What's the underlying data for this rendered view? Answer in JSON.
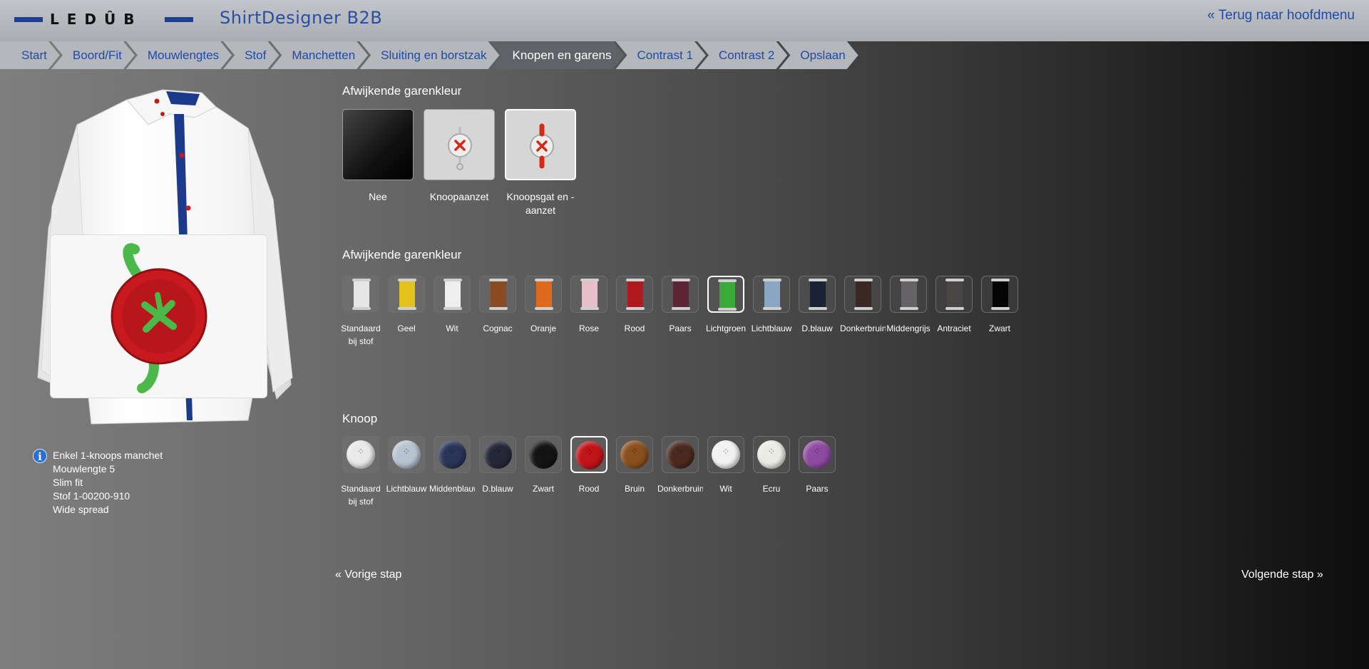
{
  "header": {
    "logo_text": "LEDÛB",
    "app_title": "ShirtDesigner B2B",
    "back_link": "« Terug naar hoofdmenu"
  },
  "breadcrumbs": [
    {
      "label": "Start",
      "active": false
    },
    {
      "label": "Boord/Fit",
      "active": false
    },
    {
      "label": "Mouwlengtes",
      "active": false
    },
    {
      "label": "Stof",
      "active": false
    },
    {
      "label": "Manchetten",
      "active": false
    },
    {
      "label": "Sluiting en borstzak",
      "active": false
    },
    {
      "label": "Knopen en garens",
      "active": true
    },
    {
      "label": "Contrast 1",
      "active": false
    },
    {
      "label": "Contrast 2",
      "active": false
    },
    {
      "label": "Opslaan",
      "active": false
    }
  ],
  "info": {
    "lines": [
      "Enkel 1-knoops manchet",
      "Mouwlengte 5",
      "Slim fit",
      "Stof 1-00200-910",
      "Wide spread"
    ]
  },
  "thread_option": {
    "title": "Afwijkende garenkleur",
    "options": [
      {
        "label": "Nee",
        "selected": false
      },
      {
        "label": "Knoopaanzet",
        "selected": false
      },
      {
        "label": "Knoopsgat en -aanzet",
        "selected": true
      }
    ]
  },
  "thread_color": {
    "title": "Afwijkende garenkleur",
    "selected": "Lichtgroen",
    "colors": [
      {
        "label": "Standaard bij stof",
        "color": "#e6e6e6"
      },
      {
        "label": "Geel",
        "color": "#e4c21c"
      },
      {
        "label": "Wit",
        "color": "#eeeeee"
      },
      {
        "label": "Cognac",
        "color": "#8a4a22"
      },
      {
        "label": "Oranje",
        "color": "#e06a1c"
      },
      {
        "label": "Rose",
        "color": "#e8bfc8"
      },
      {
        "label": "Rood",
        "color": "#b01a1e"
      },
      {
        "label": "Paars",
        "color": "#5c2434"
      },
      {
        "label": "Lichtgroen",
        "color": "#3caa3a"
      },
      {
        "label": "Lichtblauw",
        "color": "#8ba6c4"
      },
      {
        "label": "D.blauw",
        "color": "#1a2233"
      },
      {
        "label": "Donkerbruin",
        "color": "#3a2824"
      },
      {
        "label": "Middengrijs",
        "color": "#666266"
      },
      {
        "label": "Antraciet",
        "color": "#4a4646"
      },
      {
        "label": "Zwart",
        "color": "#050505"
      }
    ]
  },
  "button_color": {
    "title": "Knoop",
    "selected": "Rood",
    "colors": [
      {
        "label": "Standaard bij stof",
        "color": "#e9e9e9"
      },
      {
        "label": "Lichtblauw",
        "color": "#b7c4d0"
      },
      {
        "label": "Middenblauw",
        "color": "#2a3558"
      },
      {
        "label": "D.blauw",
        "color": "#262838"
      },
      {
        "label": "Zwart",
        "color": "#141414"
      },
      {
        "label": "Rood",
        "color": "#c01418"
      },
      {
        "label": "Bruin",
        "color": "#8a4f1c"
      },
      {
        "label": "Donkerbruin",
        "color": "#4a2a1e"
      },
      {
        "label": "Wit",
        "color": "#f2f2f2"
      },
      {
        "label": "Ecru",
        "color": "#ebebe6"
      },
      {
        "label": "Paars",
        "color": "#8e4aa0"
      }
    ]
  },
  "nav": {
    "prev": "« Vorige stap",
    "next": "Volgende stap »"
  },
  "colors": {
    "accent": "#1f4aa8",
    "crumb_active": "#5f6368",
    "shirt_placket": "#1c3a8c",
    "button_red": "#c81a1e",
    "thread_green": "#4bb84a"
  }
}
